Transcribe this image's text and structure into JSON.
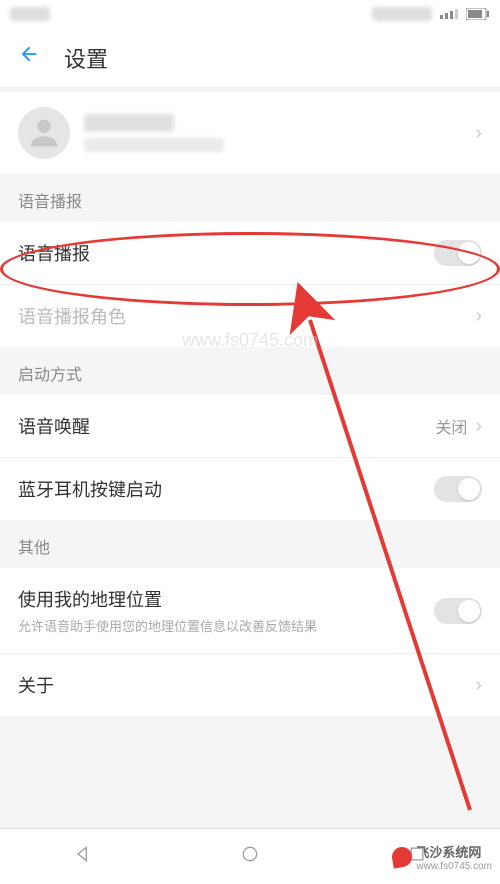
{
  "header": {
    "title": "设置"
  },
  "sections": {
    "voice": {
      "header": "语音播报",
      "broadcast_label": "语音播报",
      "role_label": "语音播报角色"
    },
    "startup": {
      "header": "启动方式",
      "wake_label": "语音唤醒",
      "wake_value": "关闭",
      "bluetooth_label": "蓝牙耳机按键启动"
    },
    "other": {
      "header": "其他",
      "location_label": "使用我的地理位置",
      "location_sub": "允许语音助手使用您的地理位置信息以改善反馈结果",
      "about_label": "关于"
    }
  },
  "annotation": {
    "watermark_top": "www.fs0745.com",
    "watermark_bottom_brand": "飞沙系统网",
    "watermark_bottom_url": "www.fs0745.com"
  }
}
